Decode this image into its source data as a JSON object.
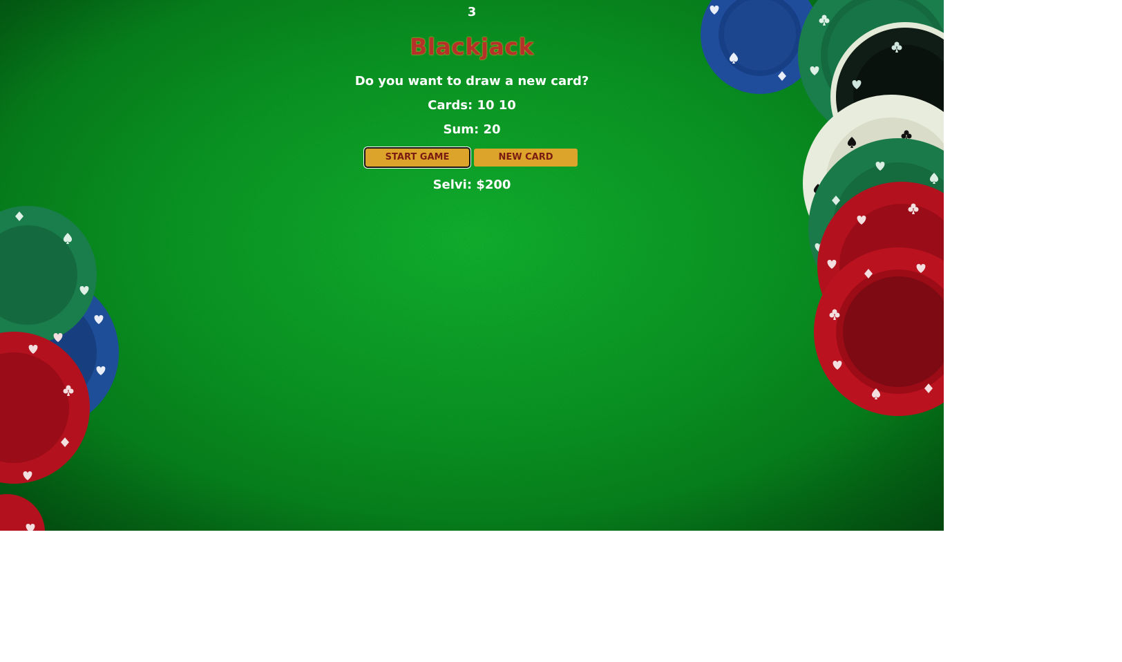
{
  "counter": "3",
  "title": "Blackjack",
  "message": "Do you want to draw a new card?",
  "cards_text": "Cards: 10 10",
  "sum_text": "Sum: 20",
  "buttons": {
    "start_label": "START GAME",
    "new_card_label": "NEW CARD"
  },
  "player_text": "Selvi: $200",
  "colors": {
    "felt": "#0b9a29",
    "title": "#b5322a",
    "button_bg": "#dca42a",
    "button_text": "#7a1b12",
    "text": "#ffffff"
  },
  "decor": {
    "chip_colors": [
      "#1f4d9c",
      "#1a7d4c",
      "#0e1a14",
      "#e8ecdc",
      "#b3111e"
    ],
    "chip_suit_icons": [
      "spade-icon",
      "heart-icon",
      "club-icon",
      "diamond-icon"
    ]
  }
}
